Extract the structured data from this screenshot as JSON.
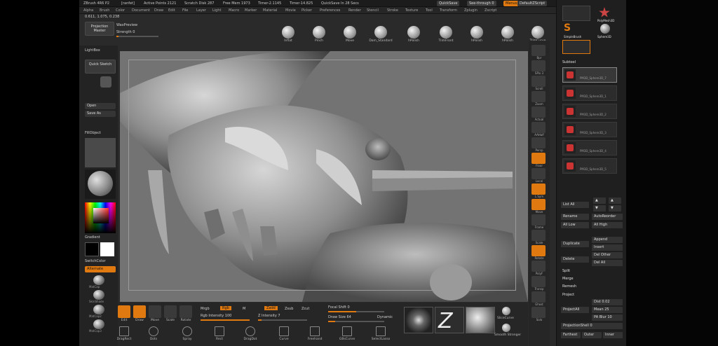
{
  "titlebar": {
    "app": "ZBrush 4R6 P2",
    "doc": "[ranfet]",
    "active_points": "Active Points 2121",
    "scratch": "Scratch Disk 287",
    "free_mem": "Free Mem 1973",
    "timer": "Timer-2.1145",
    "timer2": "Timer-14.825",
    "quicksave": "QuickSave In 28 Secs",
    "quick_btn": "QuickSave",
    "see_through": "See-through 0",
    "menus_btn": "Menus",
    "script_btn": "DefaultZScript"
  },
  "menu": [
    "Alpha",
    "Brush",
    "Color",
    "Document",
    "Draw",
    "Edit",
    "File",
    "Layer",
    "Light",
    "Macro",
    "Marker",
    "Material",
    "Movie",
    "Picker",
    "Preferences",
    "Render",
    "Stencil",
    "Stroke",
    "Texture",
    "Tool",
    "Transform",
    "Zplugin",
    "Zscript"
  ],
  "coords": "0.611, 1.075, 0.238",
  "top_left": {
    "projection_master": "Projection Master",
    "wax_preview": "WaxPreview",
    "strength": "Strength 0"
  },
  "brushes": [
    "Inflat",
    "Pinch",
    "Move",
    "Dam_Standard",
    "hPolish",
    "TrimFront",
    "hPolish",
    "hPolish",
    "TrimCurve"
  ],
  "left_tray": {
    "lightbox": "LightBox",
    "quick_sketch": "Quick Sketch",
    "open": "Open",
    "save_as": "Save As",
    "fill_object": "FillObject",
    "gradient": "Gradient",
    "switch_color": "SwitchColor",
    "alternate": "Alternate",
    "mats": [
      "MatCap",
      "SkinShade",
      "MatCap2",
      "MatCap3"
    ]
  },
  "right_strip": [
    "Bpr",
    "SPix 3",
    "Scroll",
    "Zoom",
    "Actual",
    "AAHalf",
    "Persp",
    "Floor",
    "Local",
    "L.Sym",
    "Move",
    "Frame",
    "Scale",
    "Rotate",
    "PolyF",
    "Transp",
    "Ghost",
    "Solo"
  ],
  "right_panel": {
    "subtool": "Subtool",
    "subtools": [
      "PM3D_Sphere3D_7",
      "PM3D_Sphere3D_1",
      "PM3D_Sphere3D_2",
      "PM3D_Sphere3D_3",
      "PM3D_Sphere3D_4",
      "PM3D_Sphere3D_5"
    ],
    "list_all": "List All",
    "rename": "Rename",
    "auto_reorder": "AutoReorder",
    "all_low": "All Low",
    "all_high": "All High",
    "duplicate": "Duplicate",
    "append": "Append",
    "insert": "Insert",
    "del_other": "Del Other",
    "delete": "Delete",
    "del_all": "Del All",
    "split": "Split",
    "merge": "Merge",
    "remesh": "Remesh",
    "project": "Project",
    "project_all": "ProjectAll",
    "dist": "Dist 0.02",
    "mean": "Mean 25",
    "pa_blur": "PA Blur 10",
    "projection_shell": "ProjectionShell 0",
    "farthest": "Farthest",
    "outer": "Outer",
    "inner": "Inner",
    "top_thumbs": [
      "PolyMesh3D",
      "SimpleBrush",
      "Sphere3D"
    ]
  },
  "bottom": {
    "edit": "Edit",
    "draw": "Draw",
    "move": "Move",
    "scale": "Scale",
    "rotate": "Rotate",
    "mrgb": "Mrgb",
    "rgb": "Rgb",
    "m": "M",
    "zadd": "Zadd",
    "zsub": "Zsub",
    "zcut": "Zcut",
    "rgb_intensity": "Rgb Intensity 100",
    "z_intensity": "Z Intensity 7",
    "focal_shift": "Focal Shift 0",
    "draw_size": "Draw Size 64",
    "dynamic": "Dynamic",
    "tools": [
      "DragRect",
      "Dots",
      "Spray",
      "Rect",
      "DragDot",
      "Curve",
      "Freehand",
      "GBsCurve",
      "SelectLasso"
    ],
    "thumbs": [
      "Alpha",
      "Stroke",
      "Texture"
    ],
    "slice_curve": "SliceCurve",
    "clip_curve": "Smooth Stronger"
  }
}
